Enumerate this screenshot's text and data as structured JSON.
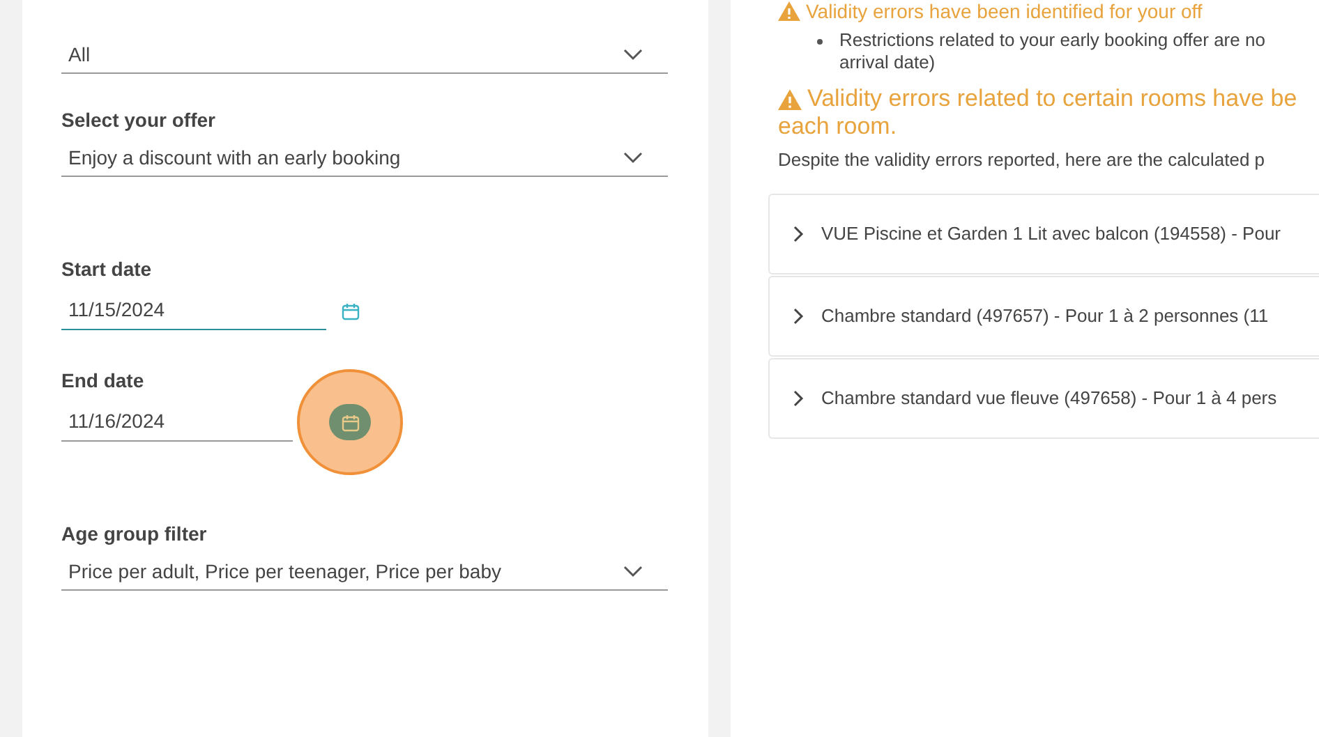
{
  "form": {
    "fields": [
      {
        "kind": "select",
        "value": "All",
        "focused": false
      },
      {
        "kind": "select",
        "label": "Select your offer",
        "value": "Enjoy a discount with an early booking",
        "focused": false
      },
      {
        "kind": "date",
        "label": "Start date",
        "value": "11/15/2024",
        "focused": true,
        "highlighted": false
      },
      {
        "kind": "date",
        "label": "End date",
        "value": "11/16/2024",
        "focused": false,
        "highlighted": true
      },
      {
        "kind": "select",
        "label": "Age group filter",
        "value": "Price per adult, Price per teenager, Price per baby",
        "focused": false
      }
    ]
  },
  "results": {
    "offer_warning": "Validity errors have been identified for your off",
    "restrictions": [
      "Restrictions related to your early booking offer are no",
      "arrival date)"
    ],
    "room_warning": [
      "Validity errors related to certain rooms have be",
      "each room."
    ],
    "note": "Despite the validity errors reported, here are the calculated p",
    "rooms": [
      {
        "title": "VUE Piscine et Garden 1 Lit avec balcon (194558) - Pour",
        "expanded": false
      },
      {
        "title": "Chambre standard (497657) - Pour 1 à 2 personnes (11",
        "expanded": false
      },
      {
        "title": "Chambre standard vue fleuve (497658) - Pour 1 à 4 pers",
        "expanded": false
      }
    ]
  }
}
